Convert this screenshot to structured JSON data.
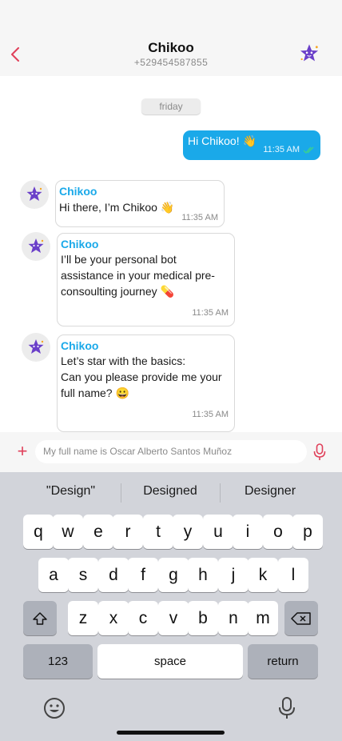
{
  "header": {
    "title": "Chikoo",
    "phone": "+529454587855",
    "back_icon": "chevron-left-icon",
    "avatar_icon": "purple-star-icon",
    "accent_color": "#e0405a"
  },
  "chat": {
    "date_label": "friday",
    "outgoing": [
      {
        "text": "Hi Chikoo! 👋",
        "time": "11:35 AM",
        "status_icon": "double-check-icon"
      }
    ],
    "incoming": [
      {
        "sender": "Chikoo",
        "lines": [
          "Hi there, I’m Chikoo 👋"
        ],
        "time": "11:35 AM"
      },
      {
        "sender": "Chikoo",
        "lines": [
          "I’ll be your personal bot",
          "assistance in your medical pre-",
          "consoulting journey 💊"
        ],
        "time": "11:35 AM"
      },
      {
        "sender": "Chikoo",
        "lines": [
          "Let’s star with the basics:",
          "Can you please provide me your",
          "full name? 😀"
        ],
        "time": "11:35 AM"
      }
    ],
    "bubble_color": "#1aa9e9"
  },
  "composer": {
    "plus_icon": "plus-icon",
    "input_value": "My full name is Oscar Alberto Santos Muñoz",
    "mic_icon": "microphone-icon"
  },
  "keyboard": {
    "suggestions": [
      "\"Design\"",
      "Designed",
      "Designer"
    ],
    "row1": [
      "q",
      "w",
      "e",
      "r",
      "t",
      "y",
      "u",
      "i",
      "o",
      "p"
    ],
    "row2": [
      "a",
      "s",
      "d",
      "f",
      "g",
      "h",
      "j",
      "k",
      "l"
    ],
    "row3": [
      "z",
      "x",
      "c",
      "v",
      "b",
      "n",
      "m"
    ],
    "shift_icon": "shift-icon",
    "backspace_icon": "backspace-icon",
    "numbers_label": "123",
    "space_label": "space",
    "return_label": "return",
    "emoji_icon": "emoji-icon",
    "dictation_icon": "microphone-icon"
  }
}
